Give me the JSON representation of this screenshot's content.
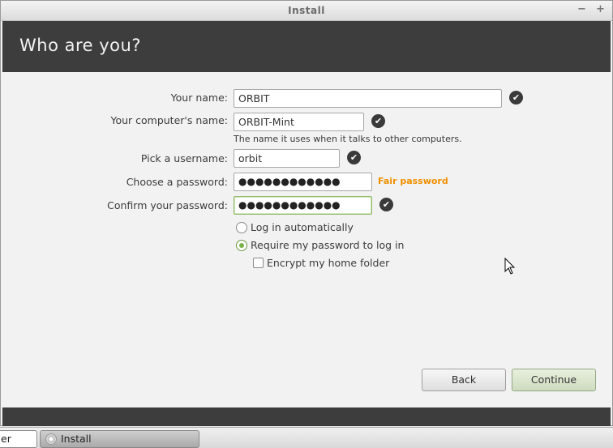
{
  "window": {
    "title": "Install",
    "minimize_glyph": "−",
    "maximize_glyph": "+"
  },
  "header": {
    "title": "Who are you?"
  },
  "form": {
    "name": {
      "label": "Your name:",
      "value": "ORBIT"
    },
    "computer": {
      "label": "Your computer's name:",
      "value": "ORBIT-Mint",
      "hint": "The name it uses when it talks to other computers."
    },
    "username": {
      "label": "Pick a username:",
      "value": "orbit"
    },
    "password": {
      "label": "Choose a password:",
      "value": "●●●●●●●●●●●●",
      "strength": "Fair password"
    },
    "confirm": {
      "label": "Confirm your password:",
      "value": "●●●●●●●●●●●●"
    },
    "login_auto": {
      "label": "Log in automatically",
      "selected": false
    },
    "login_require": {
      "label": "Require my password to log in",
      "selected": true
    },
    "encrypt": {
      "label": "Encrypt my home folder",
      "checked": false
    },
    "check_glyph": "✔"
  },
  "buttons": {
    "back": "Back",
    "continue": "Continue"
  },
  "taskbar": {
    "left_item": "er",
    "install_item": "Install"
  },
  "colors": {
    "header_bg": "#3d3d3d",
    "accent_green": "#78b04a",
    "strength_orange": "#f09000"
  }
}
